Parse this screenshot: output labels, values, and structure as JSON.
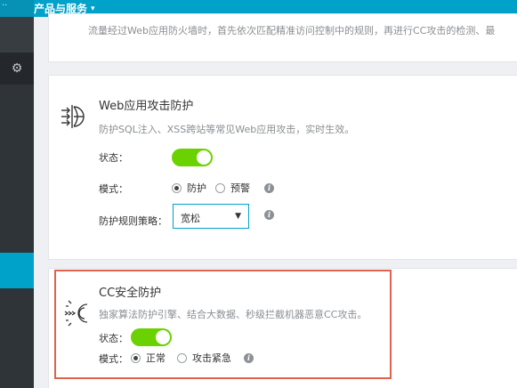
{
  "topbar": {
    "menu_label": "产品与服务",
    "caret": "▾",
    "left_glyph": "··"
  },
  "sidebar": {
    "gear_icon": "gear-icon",
    "gear_glyph": "⚙"
  },
  "card_top": {
    "description": "流量经过Web应用防火墙时，首先依次匹配精准访问控制中的规则，再进行CC攻击的检测、最"
  },
  "waf": {
    "title": "Web应用攻击防护",
    "description": "防护SQL注入、XSS跨站等常见Web应用攻击，实时生效。",
    "status_label": "状态：",
    "status_on": true,
    "mode_label": "模式：",
    "mode_options": [
      "防护",
      "预警"
    ],
    "mode_selected": "防护",
    "policy_label": "防护规则策略：",
    "policy_value": "宽松",
    "policy_arrow": "▼",
    "info_glyph": "i"
  },
  "cc": {
    "title": "CC安全防护",
    "description": "独家算法防护引擎、结合大数据、秒级拦截机器恶意CC攻击。",
    "status_label": "状态：",
    "status_on": true,
    "mode_label": "模式：",
    "mode_options": [
      "正常",
      "攻击紧急"
    ],
    "mode_selected": "正常",
    "info_glyph": "i"
  },
  "colors": {
    "accent": "#00a2ca",
    "toggle_on": "#6ad200",
    "highlight_border": "#e0614c",
    "sidebar": "#2f3438"
  }
}
